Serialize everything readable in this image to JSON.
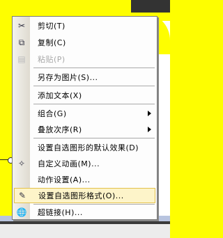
{
  "menu": {
    "items": [
      {
        "label": "剪切(T)",
        "icon": "scissors-icon",
        "disabled": false
      },
      {
        "label": "复制(C)",
        "icon": "copy-icon",
        "disabled": false
      },
      {
        "label": "粘贴(P)",
        "icon": "paste-icon",
        "disabled": true
      },
      {
        "label": "另存为图片(S)...",
        "disabled": false
      },
      {
        "label": "添加文本(X)",
        "disabled": false
      },
      {
        "label": "组合(G)",
        "submenu": true
      },
      {
        "label": "叠放次序(R)",
        "submenu": true
      },
      {
        "label": "设置自选图形的默认效果(D)"
      },
      {
        "label": "自定义动画(M)...",
        "icon": "animation-icon"
      },
      {
        "label": "动作设置(A)..."
      },
      {
        "label": "设置自选图形格式(O)...",
        "icon": "format-shape-icon",
        "highlighted": true
      },
      {
        "label": "超链接(H)...",
        "icon": "hyperlink-icon"
      }
    ]
  },
  "colors": {
    "canvas_fill": "#fefe00",
    "highlight_bg": "#fdf4c9",
    "highlight_border": "#e3c14b",
    "disabled_text": "#a7a7a7"
  }
}
